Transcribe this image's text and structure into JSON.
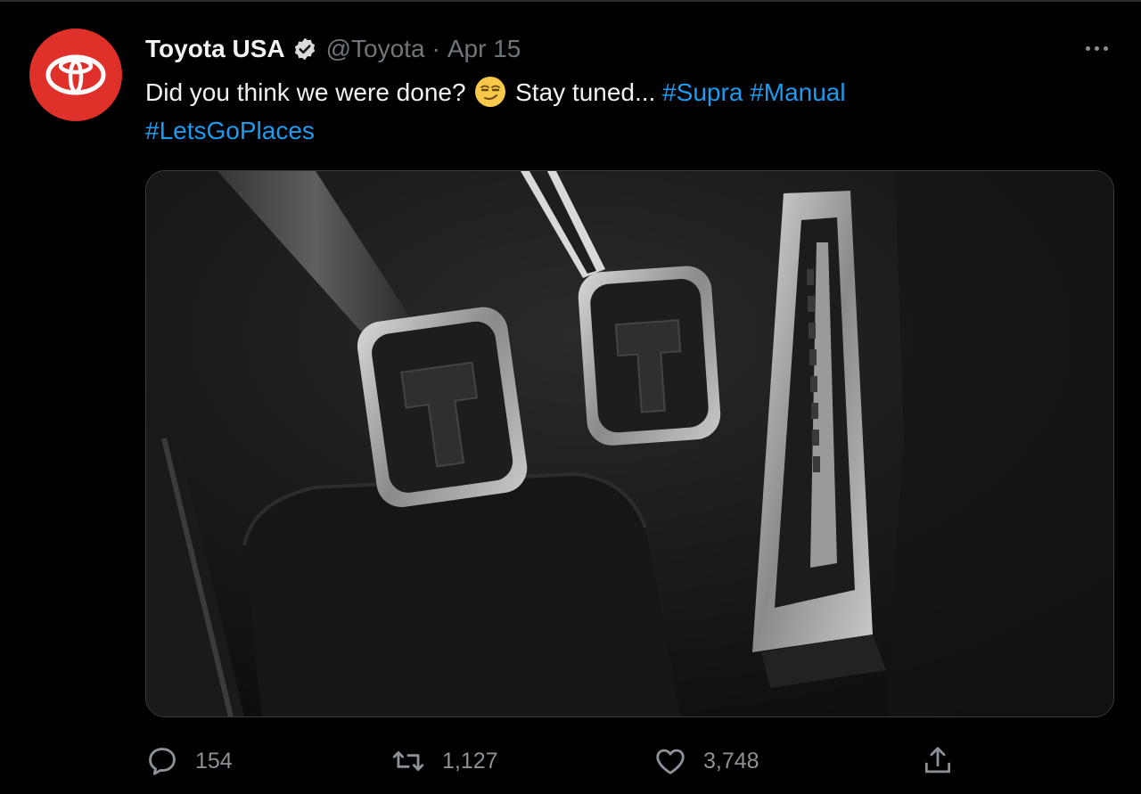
{
  "tweet": {
    "author_name": "Toyota USA",
    "handle": "@Toyota",
    "separator": "·",
    "date": "Apr 15",
    "text_before_emoji": "Did you think we were done?",
    "emoji": "smirking-face",
    "text_after_emoji": "Stay tuned...",
    "hashtags": [
      "#Supra",
      "#Manual",
      "#LetsGoPlaces"
    ]
  },
  "actions": {
    "replies": "154",
    "retweets": "1,127",
    "likes": "3,748"
  },
  "colors": {
    "background": "#000000",
    "hashtag": "#1d9bf0",
    "avatar": "#e0302a",
    "muted": "#6f767b"
  },
  "icons": [
    "verified-badge-icon",
    "more-options-icon",
    "reply-icon",
    "retweet-icon",
    "like-icon",
    "share-icon"
  ]
}
